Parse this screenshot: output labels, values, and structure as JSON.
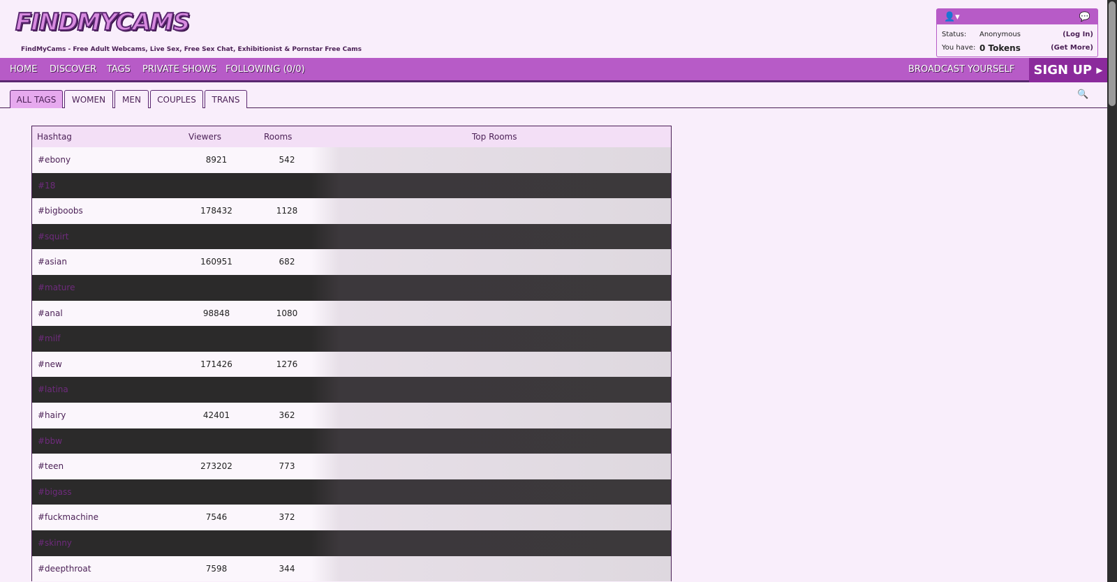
{
  "header": {
    "logo_text": "FINDMYCAMS",
    "tagline": "FindMyCams - Free Adult Webcams, Live Sex, Free Sex Chat, Exhibitionist & Pornstar Free Cams"
  },
  "user_box": {
    "user_icon": "user-icon",
    "chat_icon": "chat-icon",
    "status_label": "Status:",
    "status_value": "Anonymous",
    "login_link": "(Log In)",
    "tokens_label": "You have:",
    "tokens_value": "0 Tokens",
    "get_more_link": "(Get More)"
  },
  "nav": {
    "items": [
      "HOME",
      "DISCOVER",
      "TAGS",
      "PRIVATE SHOWS",
      "FOLLOWING (0/0)"
    ],
    "broadcast": "BROADCAST YOURSELF",
    "signup": "SIGN UP ▸"
  },
  "subtabs": [
    "ALL TAGS",
    "WOMEN",
    "MEN",
    "COUPLES",
    "TRANS"
  ],
  "table": {
    "headers": [
      "Hashtag",
      "Viewers",
      "Rooms",
      "Top Rooms"
    ],
    "rows": [
      {
        "tag": "#ebony",
        "viewers": "8921",
        "rooms": "542"
      },
      {
        "tag": "#18",
        "viewers": "",
        "rooms": ""
      },
      {
        "tag": "#bigboobs",
        "viewers": "178432",
        "rooms": "1128"
      },
      {
        "tag": "#squirt",
        "viewers": "",
        "rooms": ""
      },
      {
        "tag": "#asian",
        "viewers": "160951",
        "rooms": "682"
      },
      {
        "tag": "#mature",
        "viewers": "",
        "rooms": ""
      },
      {
        "tag": "#anal",
        "viewers": "98848",
        "rooms": "1080"
      },
      {
        "tag": "#milf",
        "viewers": "",
        "rooms": ""
      },
      {
        "tag": "#new",
        "viewers": "171426",
        "rooms": "1276"
      },
      {
        "tag": "#latina",
        "viewers": "",
        "rooms": ""
      },
      {
        "tag": "#hairy",
        "viewers": "42401",
        "rooms": "362"
      },
      {
        "tag": "#bbw",
        "viewers": "",
        "rooms": ""
      },
      {
        "tag": "#teen",
        "viewers": "273202",
        "rooms": "773"
      },
      {
        "tag": "#bigass",
        "viewers": "",
        "rooms": ""
      },
      {
        "tag": "#fuckmachine",
        "viewers": "7546",
        "rooms": "372"
      },
      {
        "tag": "#skinny",
        "viewers": "",
        "rooms": ""
      },
      {
        "tag": "#deepthroat",
        "viewers": "7598",
        "rooms": "344"
      }
    ]
  },
  "colors": {
    "nav_bg": "#b75bc7",
    "signup_bg": "#8b2a9c",
    "page_bg": "#f9eefb",
    "accent_dark": "#4a1f55"
  }
}
